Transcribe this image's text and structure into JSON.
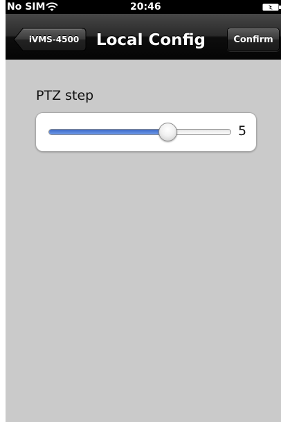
{
  "status_bar": {
    "carrier": "No SIM",
    "time": "20:46",
    "wifi_icon": "wifi-icon",
    "battery_icon": "battery-charging-icon"
  },
  "nav": {
    "back_label": "iVMS-4500",
    "title": "Local Config",
    "confirm_label": "Confirm"
  },
  "ptz": {
    "label": "PTZ step",
    "value": "5",
    "level_fraction": 0.65
  },
  "colors": {
    "background": "#cacaca",
    "slider_fill": "#3c6ac9",
    "nav_bar": "#1a1a1a"
  }
}
